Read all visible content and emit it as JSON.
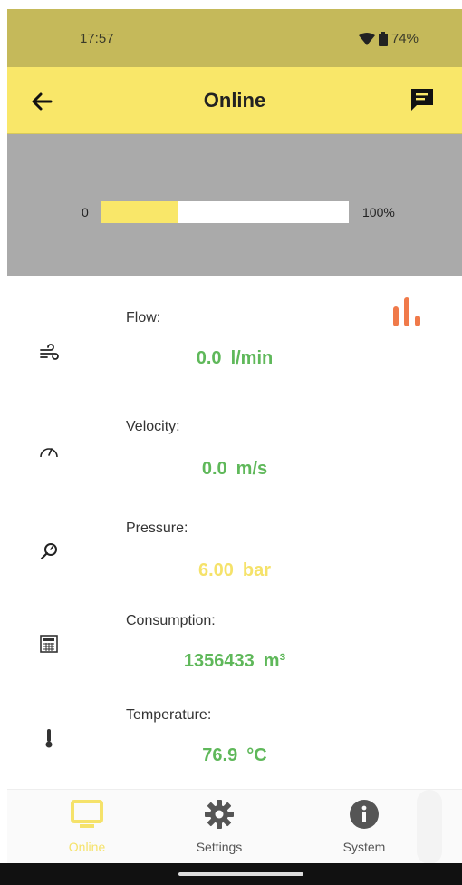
{
  "status_bar": {
    "time": "17:57",
    "battery": "74%"
  },
  "app_bar": {
    "title": "Online"
  },
  "progress": {
    "min_label": "0",
    "max_label": "100%",
    "fraction": 0.31,
    "fill_color": "#f9e769"
  },
  "metrics": [
    {
      "label": "Flow:",
      "value": "0.0",
      "unit": "l/min",
      "icon": "wind-icon",
      "color": "#5fb85a"
    },
    {
      "label": "Velocity:",
      "value": "0.0",
      "unit": "m/s",
      "icon": "speedometer-icon",
      "color": "#5fb85a"
    },
    {
      "label": "Pressure:",
      "value": "6.00",
      "unit": "bar",
      "icon": "pressure-gauge-icon",
      "color": "#f5e26a"
    },
    {
      "label": "Consumption:",
      "value": "1356433",
      "unit": "m³",
      "icon": "calculator-icon",
      "color": "#5fb85a"
    },
    {
      "label": "Temperature:",
      "value": "76.9",
      "unit": "°C",
      "icon": "thermometer-icon",
      "color": "#5fb85a"
    }
  ],
  "bottom_nav": [
    {
      "label": "Online",
      "icon": "monitor-icon",
      "active": true
    },
    {
      "label": "Settings",
      "icon": "gear-icon",
      "active": false
    },
    {
      "label": "System",
      "icon": "info-icon",
      "active": false
    }
  ],
  "colors": {
    "accent": "#f9e769",
    "chart_icon": "#f07a4a",
    "good_value": "#5fb85a"
  }
}
